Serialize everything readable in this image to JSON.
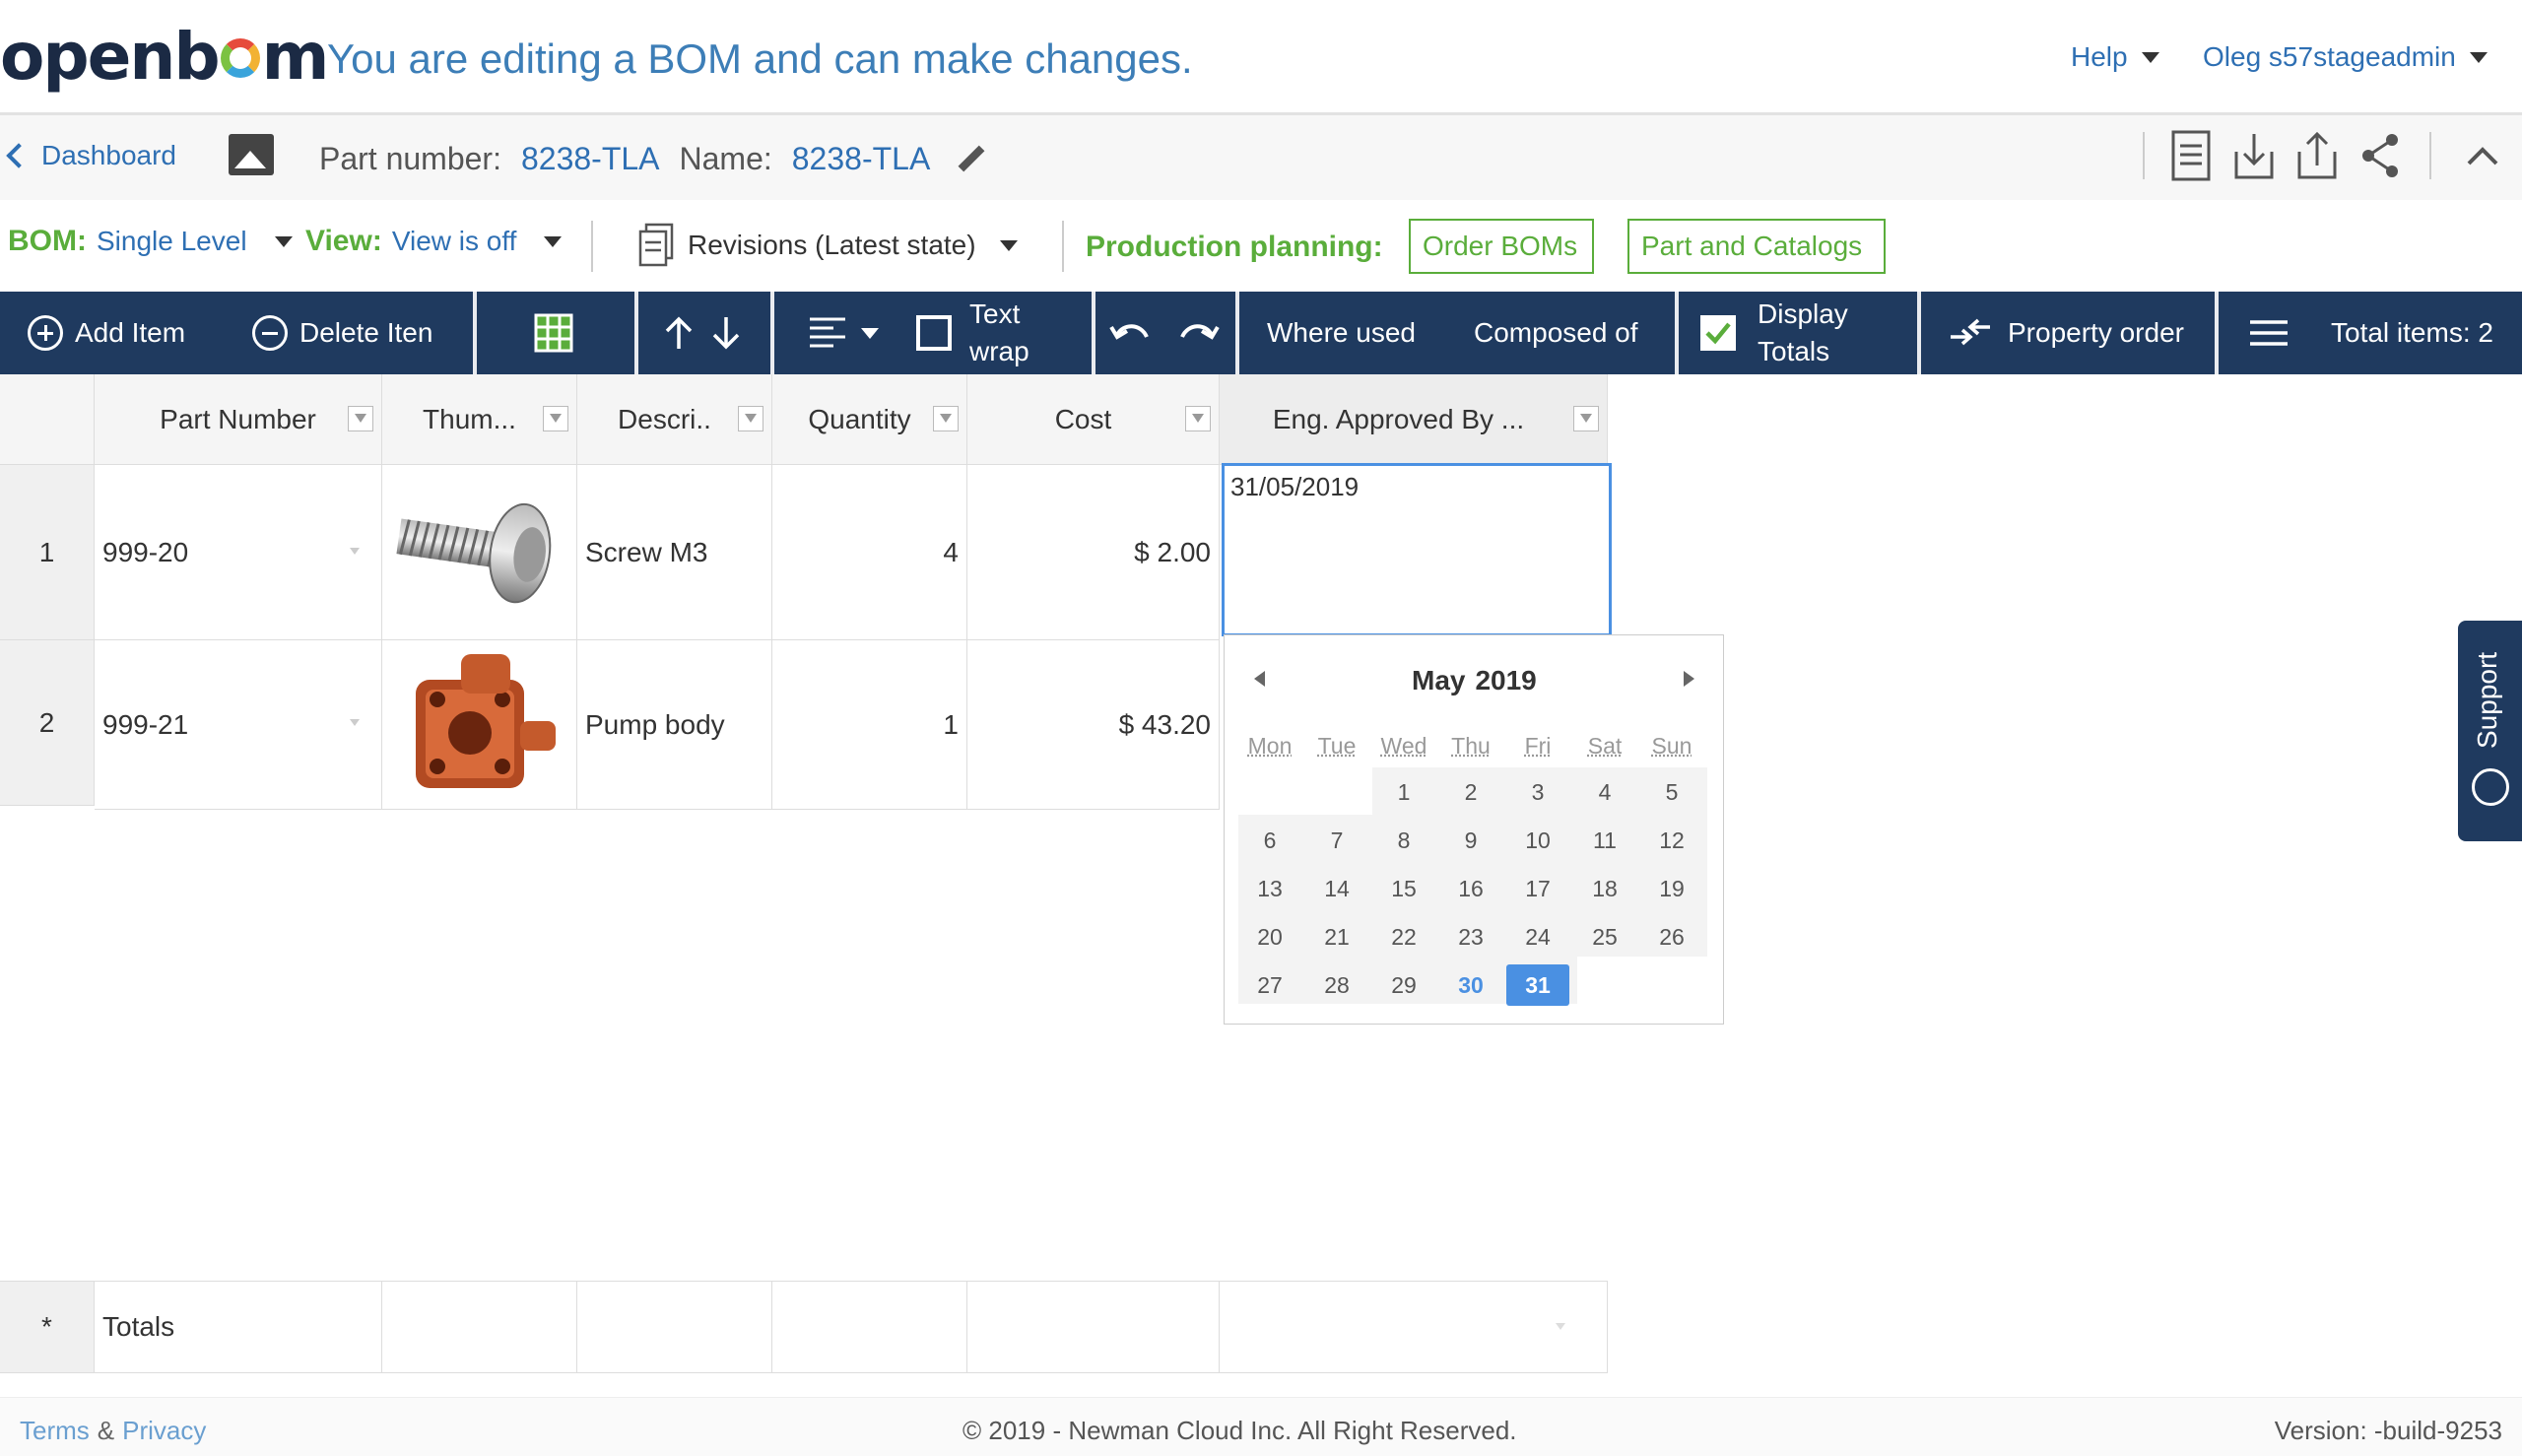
{
  "header": {
    "logo": "openbom",
    "edit_message": "You are editing a BOM and can make changes.",
    "help": "Help",
    "user": "Oleg s57stageadmin"
  },
  "part_bar": {
    "back": "Dashboard",
    "part_number_label": "Part number:",
    "part_number": "8238-TLA",
    "name_label": "Name:",
    "name": "8238-TLA"
  },
  "bom_bar": {
    "bom_label": "BOM:",
    "bom_value": "Single Level",
    "view_label": "View:",
    "view_value": "View is off",
    "revisions": "Revisions (Latest state)",
    "production_label": "Production planning:",
    "order_boms": "Order BOMs",
    "part_catalogs": "Part and Catalogs"
  },
  "toolbar": {
    "add_item": "Add Item",
    "delete_item": "Delete Iten",
    "text_wrap_1": "Text",
    "text_wrap_2": "wrap",
    "where_used": "Where used",
    "composed_of": "Composed of",
    "display_totals_1": "Display",
    "display_totals_2": "Totals",
    "property_order": "Property order",
    "total_items": "Total items: 2"
  },
  "grid": {
    "columns": [
      "Part Number",
      "Thum...",
      "Descri..",
      "Quantity",
      "Cost",
      "Eng. Approved By ..."
    ],
    "rows": [
      {
        "num": "1",
        "part_number": "999-20",
        "description": "Screw M3",
        "quantity": "4",
        "cost": "$ 2.00"
      },
      {
        "num": "2",
        "part_number": "999-21",
        "description": "Pump body",
        "quantity": "1",
        "cost": "$ 43.20"
      }
    ],
    "totals_marker": "*",
    "totals_label": "Totals"
  },
  "date_editor": {
    "value": "31/05/2019"
  },
  "datepicker": {
    "month": "May",
    "year": "2019",
    "weekdays": [
      "Mon",
      "Tue",
      "Wed",
      "Thu",
      "Fri",
      "Sat",
      "Sun"
    ],
    "days": [
      "1",
      "2",
      "3",
      "4",
      "5",
      "6",
      "7",
      "8",
      "9",
      "10",
      "11",
      "12",
      "13",
      "14",
      "15",
      "16",
      "17",
      "18",
      "19",
      "20",
      "21",
      "22",
      "23",
      "24",
      "25",
      "26",
      "27",
      "28",
      "29",
      "30",
      "31"
    ],
    "selected_day": "31",
    "today_day": "30"
  },
  "support": "Support",
  "footer": {
    "terms": "Terms",
    "amp": "&",
    "privacy": "Privacy",
    "copyright": "© 2019 - Newman Cloud Inc. All Right Reserved.",
    "version": "Version: -build-9253"
  },
  "colors": {
    "navy": "#1f3a5f",
    "link_blue": "#2e6fb3",
    "green": "#5aad3b",
    "selected_blue": "#4a90e2"
  }
}
